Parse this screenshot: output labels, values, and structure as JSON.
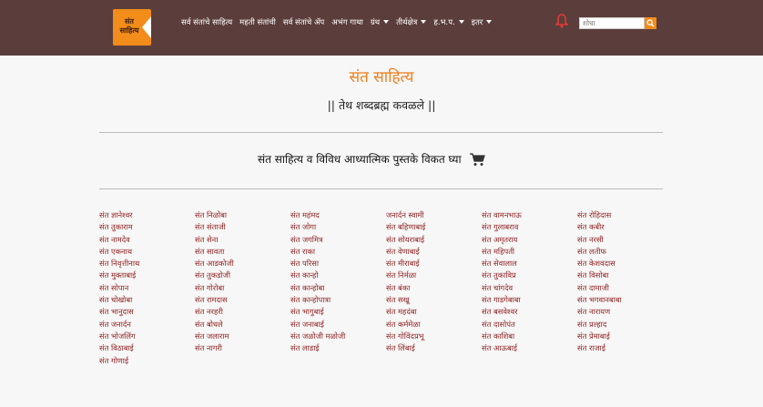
{
  "logo": {
    "text": "संत साहित्य"
  },
  "nav": {
    "items": [
      {
        "label": "सर्व संतांचे साहित्य",
        "dropdown": false
      },
      {
        "label": "महती संतांची",
        "dropdown": false
      },
      {
        "label": "सर्व संतांचे ॲप",
        "dropdown": false
      },
      {
        "label": "अभंग गाथा",
        "dropdown": false
      },
      {
        "label": "ग्रंथ",
        "dropdown": true
      },
      {
        "label": "तीर्थक्षेत्र",
        "dropdown": true
      },
      {
        "label": "ह.भ.प.",
        "dropdown": true
      },
      {
        "label": "इतर",
        "dropdown": true
      }
    ],
    "search_placeholder": "शोधा"
  },
  "page": {
    "title": "संत साहित्य",
    "subtitle": "|| तेथ शब्दब्रह्म कवळले ||",
    "promo": "संत साहित्य व विविध आध्यात्मिक पुस्तके विकत घ्या"
  },
  "colors": {
    "nav_bg": "#5b3e3b",
    "accent": "#f28c1a",
    "link": "#8b1a1a"
  },
  "saints": [
    [
      "संत ज्ञानेश्वर",
      "संत तुकाराम",
      "संत नामदेव",
      "संत एकनाथ",
      "संत निवृत्तीनाथ",
      "संत मुक्ताबाई",
      "संत सोपान",
      "संत चोखोबा",
      "संत भानुदास",
      "संत जनार्दन",
      "संत भोजलिंग",
      "संत विठाबाई",
      "संत गोणाई"
    ],
    [
      "संत निळोबा",
      "संत संताजी",
      "संत सेना",
      "संत सावता",
      "संत आडकोजी",
      "संत तुकडोजी",
      "संत गोरोबा",
      "संत रामदास",
      "संत नरहरी",
      "संत बोधले",
      "संत जलाराम",
      "संत नागरी"
    ],
    [
      "संत महंमद",
      "संत जोगा",
      "संत जगमित्र",
      "संत राका",
      "संत परिसा",
      "संत कान्हो",
      "संत कान्होबा",
      "संत कान्होपात्रा",
      "संत भागुबाई",
      "संत जनाबाई",
      "संत जळोजी मळोजी",
      "संत लाडाई"
    ],
    [
      "जनार्दन स्वामी",
      "संत बहिणाबाई",
      "संत सोयराबाई",
      "संत वेणाबाई",
      "संत मीराबाई",
      "संत निर्मळा",
      "संत बंका",
      "संत सखू",
      "संत महदंबा",
      "संत कर्ममेळा",
      "संत गोविंदप्रभू",
      "संत लिंबाई"
    ],
    [
      "संत वामनभाऊ",
      "संत गुलाबराव",
      "संत अमृतराय",
      "संत महिपती",
      "संत सेवालाल",
      "संत तुकाविप्र",
      "संत चांगदेव",
      "संत गाडगेबाबा",
      "संत बसवेश्वर",
      "संत दासोपंत",
      "संत काशिबा",
      "संत आऊबाई"
    ],
    [
      "संत रोहिदास",
      "संत कबीर",
      "संत नरसी",
      "संत लतीफ",
      "संत केशवदास",
      "संत विसोबा",
      "संत दामाजी",
      "संत भगवानबाबा",
      "संत नारायण",
      "संत प्रल्हाद",
      "संत प्रेमाबाई",
      "संत राजाई"
    ]
  ]
}
